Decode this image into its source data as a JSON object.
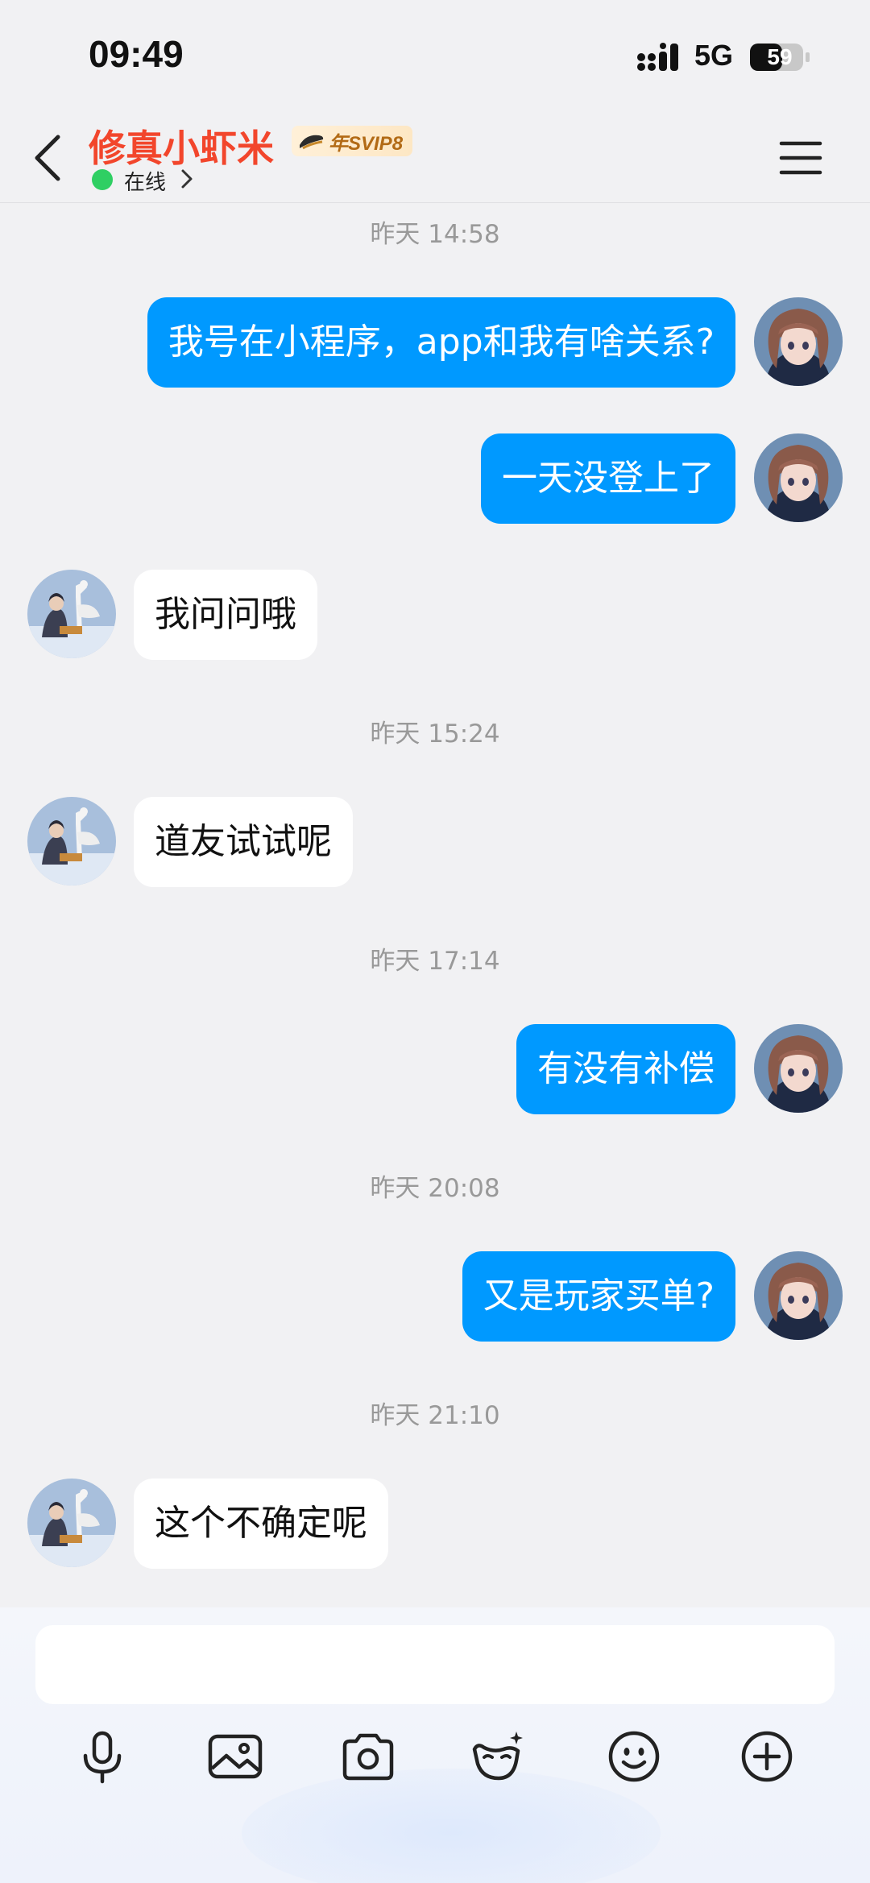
{
  "status_bar": {
    "time": "09:49",
    "network": "5G",
    "battery": "59"
  },
  "header": {
    "contact_name": "修真小虾米",
    "vip_badge": "年SVIP8",
    "status": "在线"
  },
  "messages": [
    {
      "type": "timestamp",
      "text": "昨天 14:58"
    },
    {
      "type": "outgoing",
      "text": "我号在小程序，app和我有啥关系?"
    },
    {
      "type": "outgoing",
      "text": "一天没登上了"
    },
    {
      "type": "incoming",
      "text": "我问问哦"
    },
    {
      "type": "timestamp",
      "text": "昨天 15:24"
    },
    {
      "type": "incoming",
      "text": "道友试试呢"
    },
    {
      "type": "timestamp",
      "text": "昨天 17:14"
    },
    {
      "type": "outgoing",
      "text": "有没有补偿"
    },
    {
      "type": "timestamp",
      "text": "昨天 20:08"
    },
    {
      "type": "outgoing",
      "text": "又是玩家买单?"
    },
    {
      "type": "timestamp",
      "text": "昨天 21:10"
    },
    {
      "type": "incoming",
      "text": "这个不确定呢"
    }
  ],
  "composer": {
    "input_value": "",
    "tools": [
      "microphone-icon",
      "image-icon",
      "camera-icon",
      "face-effect-icon",
      "emoji-icon",
      "add-icon"
    ]
  },
  "colors": {
    "outgoing_bubble": "#0099ff",
    "incoming_bubble": "#ffffff",
    "contact_name": "#f2462c",
    "online": "#2fcf63",
    "background": "#f1f1f3"
  }
}
